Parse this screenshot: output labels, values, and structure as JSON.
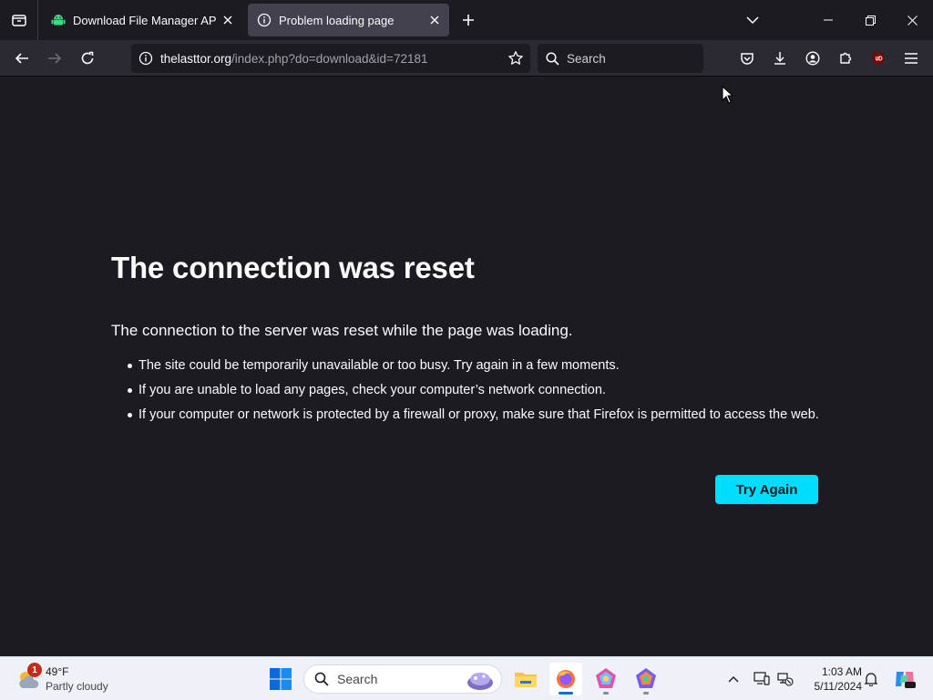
{
  "browser": {
    "tabs": [
      {
        "title": "Download File Manager APK - L",
        "icon": "android-icon",
        "active": false
      },
      {
        "title": "Problem loading page",
        "icon": "info-icon",
        "active": true
      }
    ],
    "url": {
      "host": "thelasttor.org",
      "path": "/index.php?do=download&id=72181"
    },
    "search_placeholder": "Search"
  },
  "error_page": {
    "title": "The connection was reset",
    "subtitle": "The connection to the server was reset while the page was loading.",
    "bullets": [
      "The site could be temporarily unavailable or too busy. Try again in a few moments.",
      "If you are unable to load any pages, check your computer’s network connection.",
      "If your computer or network is protected by a firewall or proxy, make sure that Firefox is permitted to access the web."
    ],
    "button_label": "Try Again",
    "accent_color": "#00ddff"
  },
  "taskbar": {
    "weather": {
      "temp": "49°F",
      "condition": "Partly cloudy",
      "badge": "1"
    },
    "search_placeholder": "Search",
    "clock": {
      "time": "1:03 AM",
      "date": "5/11/2024"
    }
  }
}
